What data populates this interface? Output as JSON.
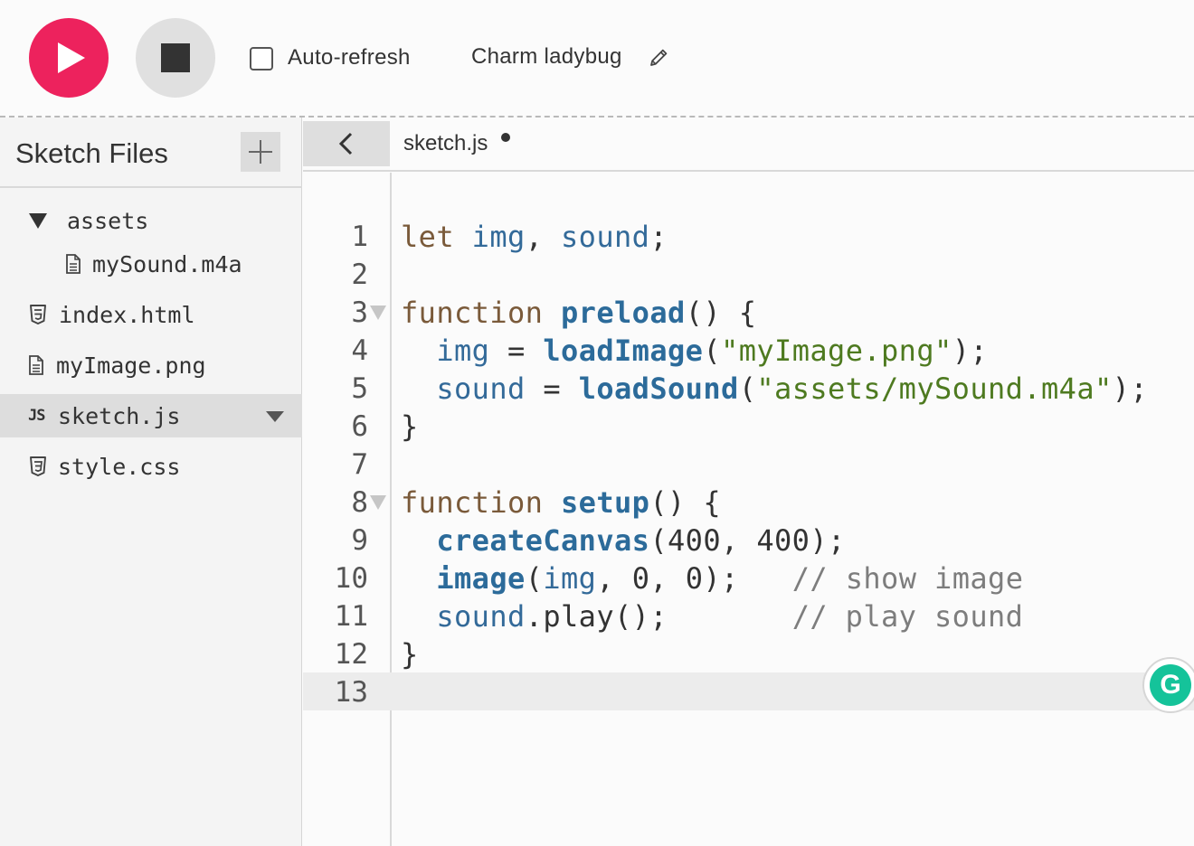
{
  "toolbar": {
    "play_label": "Play",
    "stop_label": "Stop",
    "autorefresh_label": "Auto-refresh",
    "autorefresh_checked": false,
    "project_name": "Charm ladybug"
  },
  "sidebar": {
    "title": "Sketch Files",
    "files": [
      {
        "name": "assets",
        "type": "folder",
        "expanded": true
      },
      {
        "name": "mySound.m4a",
        "type": "file"
      },
      {
        "name": "index.html",
        "type": "html"
      },
      {
        "name": "myImage.png",
        "type": "file"
      },
      {
        "name": "sketch.js",
        "type": "js",
        "selected": true
      },
      {
        "name": "style.css",
        "type": "css"
      }
    ]
  },
  "editor": {
    "tab_filename": "sketch.js",
    "unsaved": true,
    "active_line": 13,
    "line_numbers": [
      "1",
      "2",
      "3",
      "4",
      "5",
      "6",
      "7",
      "8",
      "9",
      "10",
      "11",
      "12",
      "13"
    ],
    "lines": [
      "let img, sound;",
      "",
      "function preload() {",
      "  img = loadImage(\"myImage.png\");",
      "  sound = loadSound(\"assets/mySound.m4a\");",
      "}",
      "",
      "function setup() {",
      "  createCanvas(400, 400);",
      "  image(img, 0, 0);   // show image",
      "  sound.play();       // play sound",
      "}",
      ""
    ]
  },
  "icons": {
    "play": "play-icon",
    "stop": "stop-icon",
    "pencil": "pencil-icon",
    "add": "plus-icon",
    "folder_caret": "caret-down-icon",
    "html_file": "html5-icon",
    "css_file": "css3-icon",
    "generic_file": "file-icon",
    "js_file": "js-icon",
    "collapse": "chevron-left-icon",
    "grammarly": "grammarly-icon"
  },
  "colors": {
    "accent": "#ed225d",
    "keyword": "#7a5a3a",
    "variable": "#336a99",
    "function": "#2c6b9a",
    "string": "#4e7a20",
    "comment": "#7d7d7d",
    "grammarly": "#15c39a"
  }
}
